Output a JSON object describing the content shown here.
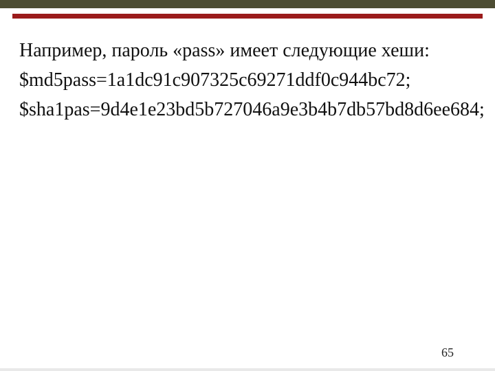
{
  "header": {},
  "content": {
    "p1": "Например, пароль «pass» имеет следующие хеши:",
    "p2": "$md5pass=1a1dc91c907325c69271ddf0c944bc72;",
    "p3": "$sha1pas=9d4e1e23bd5b727046a9e3b4b7db57bd8d6ee684;"
  },
  "page_number": "65"
}
